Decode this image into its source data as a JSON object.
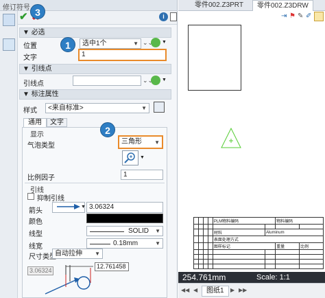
{
  "panel": {
    "title": "修订符号",
    "sections": {
      "required": "必选",
      "leader_point": "引线点",
      "annotation_props": "标注属性"
    },
    "required": {
      "position_label": "位置",
      "position_value": "选中1个",
      "text_label": "文字",
      "text_value": "1"
    },
    "leader": {
      "label": "引线点"
    },
    "style": {
      "label": "样式",
      "value": "<来自标准>"
    },
    "tabs": [
      "通用",
      "文字"
    ],
    "display": {
      "heading": "显示",
      "bubble_type_label": "气泡类型",
      "bubble_type_value": "三角形",
      "scale_label": "比例因子",
      "scale_value": "1"
    },
    "leader_group": {
      "heading": "引线",
      "suppress_label": "抑制引线",
      "arrow_label": "箭头",
      "arrow_value": "3.06324",
      "color_label": "颜色",
      "linetype_label": "线型",
      "linetype_value": "SOLID",
      "linewidth_label": "线宽",
      "linewidth_value": "0.18mm",
      "dimtype_label": "尺寸类型",
      "dimtype_value": "自动拉伸"
    },
    "preview": {
      "dim_top": "12.761458",
      "dim_left": "3.06324"
    },
    "callouts": [
      "1",
      "2",
      "3"
    ]
  },
  "doc_tabs": [
    "零件002.Z3PRT",
    "零件002.Z3DRW"
  ],
  "status": {
    "coord": "254.761mm",
    "scale": "Scale: 1:1"
  },
  "sheet_tab": "图纸1",
  "title_block": {
    "company": "PLM物料编码",
    "material_code": "物料编码",
    "material": "材料",
    "material_value": "Aluminum",
    "surface": "表面处理方式",
    "drawing_no": "图样标记",
    "weight": "重量",
    "scale": "比例"
  },
  "colors": {
    "accent": "#2e7ec4",
    "highlight": "#e98a2a",
    "triangle": "#55cc33"
  }
}
